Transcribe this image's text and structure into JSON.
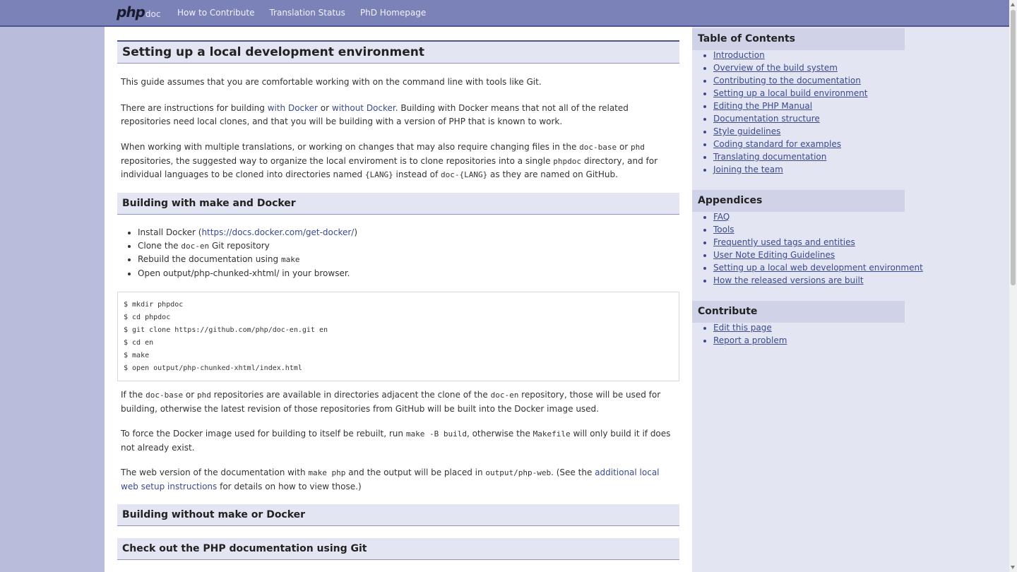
{
  "header": {
    "logo_php": "php",
    "logo_doc": "doc",
    "nav": [
      "How to Contribute",
      "Translation Status",
      "PhD Homepage"
    ]
  },
  "main": {
    "title": "Setting up a local development environment",
    "intro": "This guide assumes that you are comfortable working with on the command line with tools like Git.",
    "p2": {
      "a": "There are instructions for building ",
      "link1": "with Docker",
      "b": " or ",
      "link2": "without Docker",
      "c": ". Building with Docker means that not all of the related repositories need local clones, and that you will be building with a version of PHP that is known to work."
    },
    "p3": {
      "a": "When working with multiple translations, or working on changes that may also require changing files in the ",
      "code1": "doc-base",
      "b": " or ",
      "code2": "phd",
      "c": " repositories, the suggested way to organize the local enviroment is to clone repositories into a single ",
      "code3": "phpdoc",
      "d": " directory, and for individual languages to be cloned into directories named ",
      "code4": "{LANG}",
      "e": " instead of ",
      "code5": "doc-{LANG}",
      "f": " as they are named on GitHub."
    },
    "section1_title": "Building with make and Docker",
    "list": {
      "i1a": "Install Docker (",
      "i1link": "https://docs.docker.com/get-docker/",
      "i1b": ")",
      "i2a": "Clone the ",
      "i2code": "doc-en",
      "i2b": " Git repository",
      "i3a": "Rebuild the documentation using ",
      "i3code": "make",
      "i4": "Open output/php-chunked-xhtml/ in your browser."
    },
    "code_block": "$ mkdir phpdoc\n$ cd phpdoc\n$ git clone https://github.com/php/doc-en.git en\n$ cd en\n$ make\n$ open output/php-chunked-xhtml/index.html",
    "p4": {
      "a": "If the ",
      "code1": "doc-base",
      "b": " or ",
      "code2": "phd",
      "c": " repositories are available in directories adjacent the clone of the ",
      "code3": "doc-en",
      "d": " repository, those will be used for building, otherwise the latest revision of those repositories from GitHub will be built into the Docker image used."
    },
    "p5": {
      "a": "To force the Docker image used for building to itself be rebuilt, run ",
      "code1": "make -B build",
      "b": ", otherwise the ",
      "code2": "Makefile",
      "c": " will only build it if does not already exist."
    },
    "p6": {
      "a": "The web version of the documentation with ",
      "code1": "make php",
      "b": " and the output will be placed in ",
      "code2": "output/php-web",
      "c": ". (See the ",
      "link": "additional local web setup instructions",
      "d": " for details on how to view those.)"
    },
    "section2_title": "Building without make or Docker",
    "section3_title": "Check out the PHP documentation using Git"
  },
  "sidebar": {
    "toc_title": "Table of Contents",
    "toc": [
      "Introduction",
      "Overview of the build system",
      "Contributing to the documentation",
      "Setting up a local build environment",
      "Editing the PHP Manual",
      "Documentation structure",
      "Style guidelines",
      "Coding standard for examples",
      "Translating documentation",
      "Joining the team"
    ],
    "appendices_title": "Appendices",
    "appendices": [
      "FAQ",
      "Tools",
      "Frequently used tags and entities",
      "User Note Editing Guidelines",
      "Setting up a local web development environment",
      "How the released versions are built"
    ],
    "contribute_title": "Contribute",
    "contribute": [
      "Edit this page",
      "Report a problem"
    ]
  }
}
